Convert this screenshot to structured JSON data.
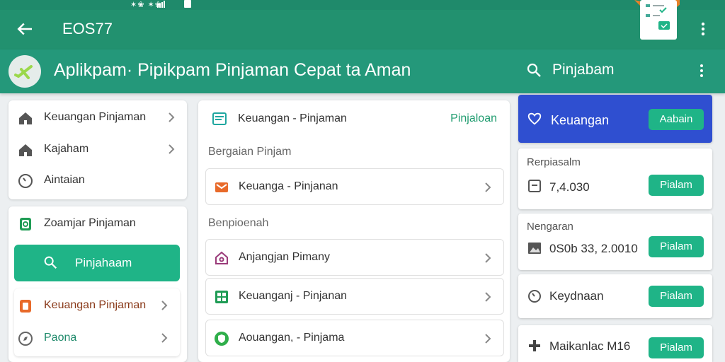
{
  "status_bar": {
    "text": "✶❀ ✶❀"
  },
  "toolbar": {
    "title": "EOS77"
  },
  "header": {
    "app_title": "Aplikpam· Pipikpam Pinjaman Cepat ta Aman",
    "search_label": "Pinjabam"
  },
  "left": {
    "menu": [
      {
        "label": "Keuangan Pinjaman",
        "icon": "home-icon"
      },
      {
        "label": "Kajaham",
        "icon": "home-icon"
      },
      {
        "label": "Aintaian",
        "icon": "clock-icon"
      }
    ],
    "section_title": "Zoamjar Pinjaman",
    "search_button": "Pinjahaam",
    "sub_items": [
      {
        "label": "Keuangan Pinjaman",
        "icon": "document-icon"
      },
      {
        "label": "Paona",
        "icon": "compass-icon"
      }
    ]
  },
  "middle": {
    "header_title": "Keuangan - Pinjaman",
    "header_link": "Pinjaloan",
    "section1": "Bergaian Pinjam",
    "section2": "Benpioenah",
    "items": [
      {
        "label": "Keuanga - Pinjanan",
        "icon": "mail-icon"
      },
      {
        "label": "Anjangjan Pimany",
        "icon": "home-outline-icon"
      },
      {
        "label": "Keuanganj - Pinjanan",
        "icon": "grid-icon"
      },
      {
        "label": "Aouangan, - Pinjama",
        "icon": "shield-icon"
      }
    ]
  },
  "right": {
    "top_card": {
      "label": "Keuangan",
      "button": "Aabain"
    },
    "cards": [
      {
        "title": "Rerpiasalm",
        "value": "7,4.030",
        "button": "Pialam",
        "icon": "square-icon"
      },
      {
        "title": "Nengaran",
        "value": "0S0b 33, 2.0010",
        "button": "Pialam",
        "icon": "image-icon"
      },
      {
        "title": "",
        "value": "Keydnaan",
        "button": "Pialam",
        "icon": "clock-icon"
      },
      {
        "title": "",
        "value": "Maikanlac M16",
        "button": "Pialam",
        "icon": "plus-icon"
      }
    ]
  },
  "colors": {
    "primary": "#22916f",
    "accent": "#1fb487",
    "blue": "#2f4fd0",
    "orange": "#e86a2a"
  }
}
